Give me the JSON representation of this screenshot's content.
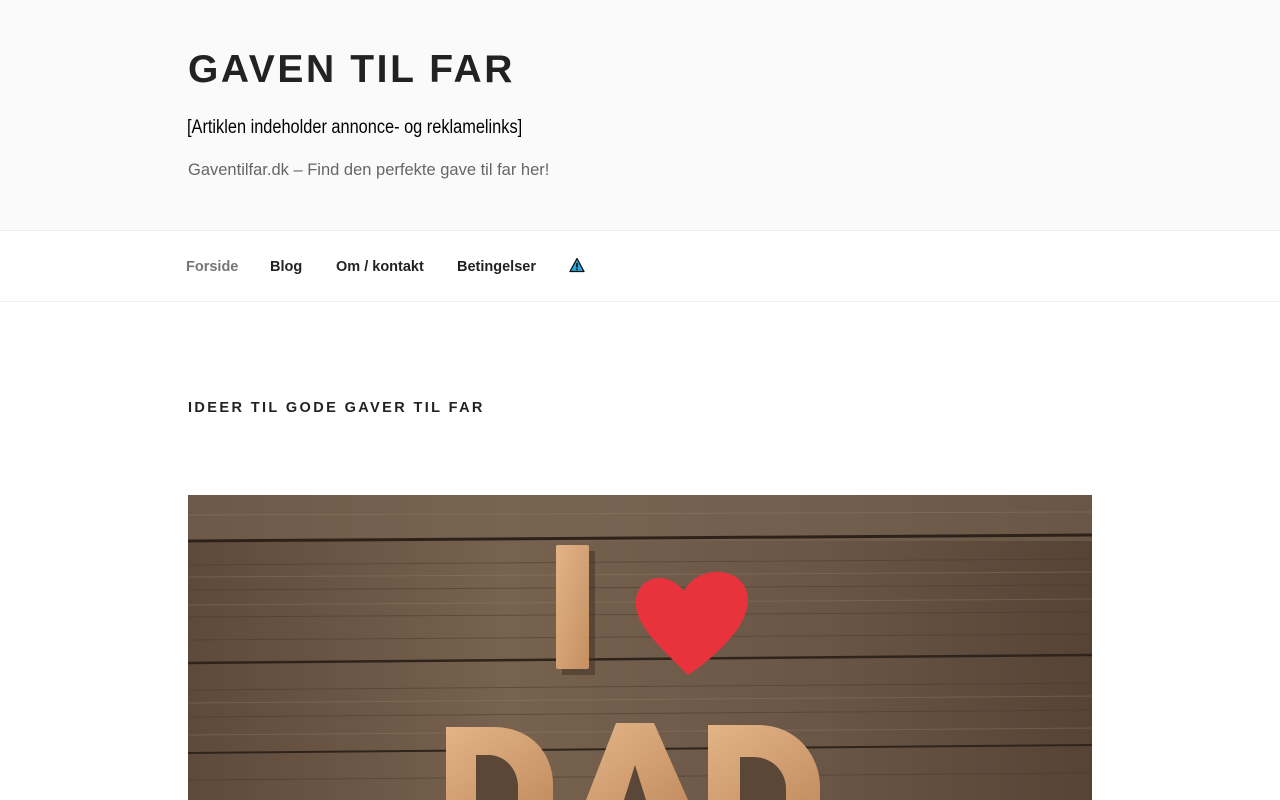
{
  "header": {
    "site_title": "GAVEN TIL FAR",
    "notice": "[Artiklen indeholder annonce- og reklamelinks]",
    "tagline": "Gaventilfar.dk – Find den perfekte gave til far her!"
  },
  "nav": {
    "items": [
      {
        "label": "Forside",
        "current": true
      },
      {
        "label": "Blog"
      },
      {
        "label": "Om / kontakt"
      },
      {
        "label": "Betingelser"
      }
    ],
    "icon": "warning-icon"
  },
  "main": {
    "section_title": "IDEER TIL GODE GAVER TIL FAR",
    "hero_image": {
      "alt_letters": "I ♥ DAD"
    }
  },
  "colors": {
    "header_bg": "#fafafa",
    "title": "#222222",
    "tagline": "#666666",
    "nav_current": "#767676",
    "heart": "#e9343d",
    "wood": "#6e5a48"
  }
}
